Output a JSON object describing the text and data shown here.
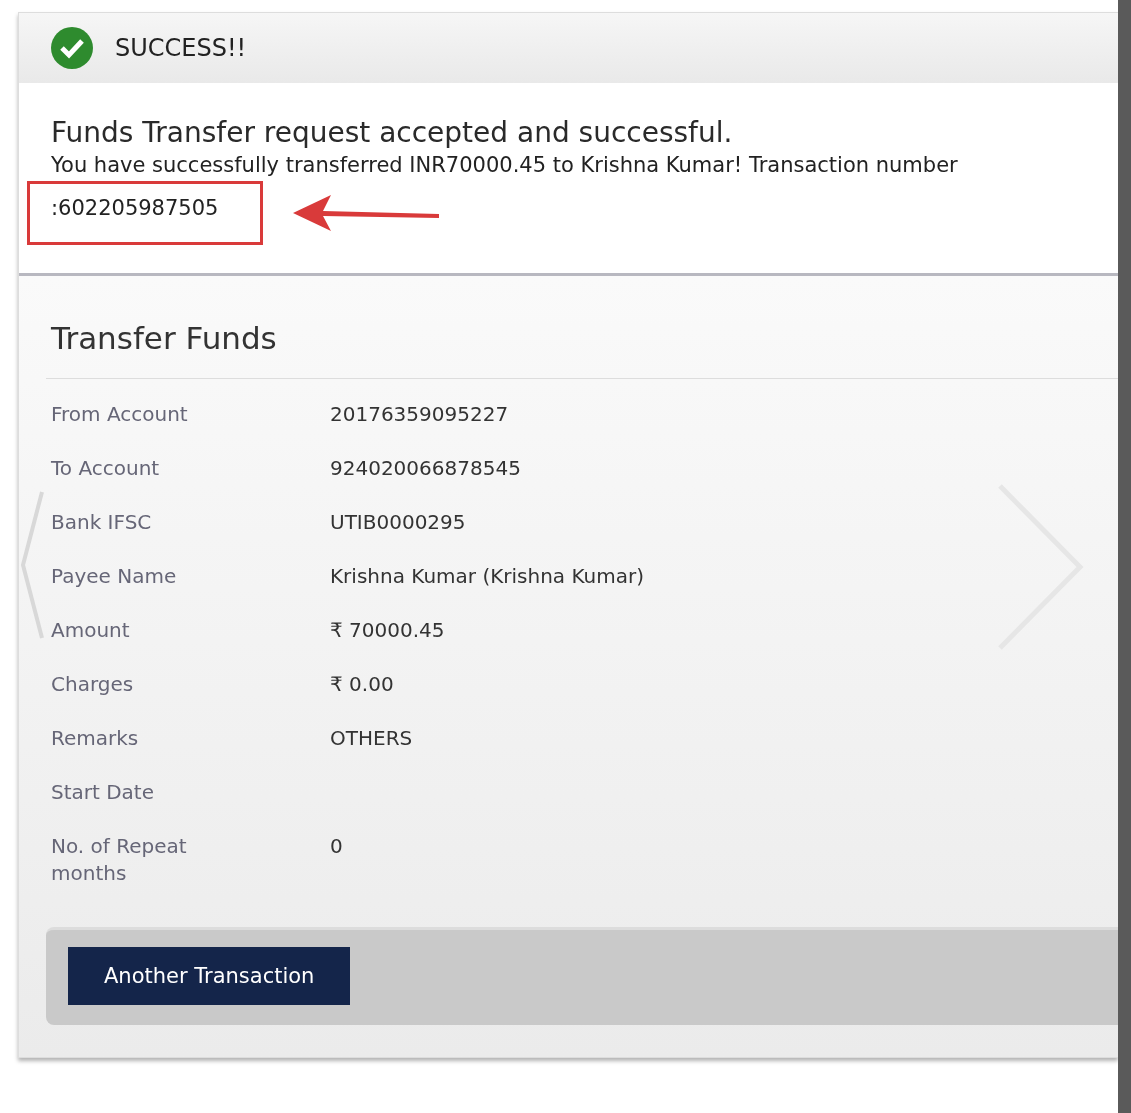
{
  "alert": {
    "kind": "success",
    "title": "SUCCESS!!"
  },
  "message": {
    "heading": "Funds Transfer request accepted and successful.",
    "detail": "You have successfully transferred INR70000.45 to Krishna Kumar! Transaction number",
    "transaction_number": ":602205987505"
  },
  "details": {
    "title": "Transfer Funds",
    "rows": [
      {
        "label": "From Account",
        "value": "20176359095227"
      },
      {
        "label": "To Account",
        "value": "924020066878545"
      },
      {
        "label": "Bank IFSC",
        "value": "UTIB0000295"
      },
      {
        "label": "Payee Name",
        "value": "Krishna Kumar (Krishna Kumar)"
      },
      {
        "label": "Amount",
        "value": "₹ 70000.45"
      },
      {
        "label": "Charges",
        "value": "₹ 0.00"
      },
      {
        "label": "Remarks",
        "value": "OTHERS"
      },
      {
        "label": "Start Date",
        "value": ""
      },
      {
        "label": "No. of Repeat months",
        "value": "0"
      }
    ]
  },
  "buttons": [
    "Another Transaction"
  ]
}
